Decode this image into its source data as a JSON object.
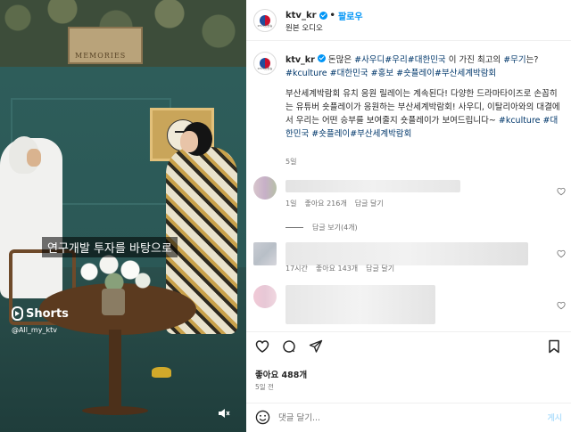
{
  "video": {
    "wall_sign": "MEMORIES",
    "subtitle": "연구개발 투자를 바탕으로",
    "shorts_label": "Shorts",
    "shorts_handle": "@All_my_ktv",
    "mute_icon": "speaker-muted-icon"
  },
  "header": {
    "username": "ktv_kr",
    "separator": "•",
    "follow_label": "팔로우",
    "audio_label": "원본 오디오",
    "avatar_caption": "KTV국민방송"
  },
  "caption": {
    "username": "ktv_kr",
    "line1_text": " 돈많은 ",
    "line1_tags": [
      "#사우디",
      "#우리",
      "#대한민국"
    ],
    "line1_mid": " 이 가진 최고의",
    "line1_tag2": "#무기",
    "line2_start": "는? ",
    "line2_tags": [
      "#kculture",
      "#대한민국",
      "#홍보",
      "#숏플레이",
      "#부산세계박람회"
    ],
    "p2_text": "부산세계박람회 유치 응원 릴레이는 계속된다! 다양한 드라마타이즈로 손꼽히는 유튜버 숏플레이가 응원하는 부산세계박람회! 사우디, 이탈리아와의 대결에서 우리는 어떤 승부를 보여줄지 숏플레이가 보여드립니다~ ",
    "p2_tags": [
      "#kculture",
      "#대한민국",
      "#숏플레이",
      "#부산세계박람회"
    ],
    "time": "5일"
  },
  "comments": [
    {
      "time": "1일",
      "likes": "좋아요 216개",
      "reply": "답글 달기",
      "view_replies": "답글 보기(4개)"
    },
    {
      "time": "17시간",
      "likes": "좋아요 143개",
      "reply": "답글 달기"
    },
    {}
  ],
  "actions": {
    "icons": [
      "heart-icon",
      "comment-icon",
      "share-icon",
      "bookmark-icon"
    ],
    "likes": "좋아요 488개",
    "date": "5일 전"
  },
  "input": {
    "placeholder": "댓글 달기...",
    "post_label": "게시"
  }
}
